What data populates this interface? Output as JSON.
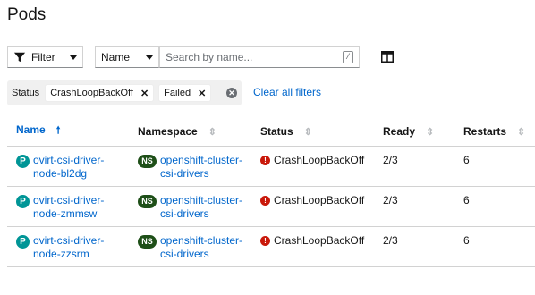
{
  "page": {
    "title": "Pods"
  },
  "toolbar": {
    "filter_label": "Filter",
    "name_select_label": "Name",
    "search_placeholder": "Search by name...",
    "search_shortcut": "/",
    "columns_icon": "columns-icon"
  },
  "filters": {
    "category": "Status",
    "chips": [
      "CrashLoopBackOff",
      "Failed"
    ],
    "clear_all_label": "Clear all filters"
  },
  "table": {
    "headers": [
      "Name",
      "Namespace",
      "Status",
      "Ready",
      "Restarts"
    ],
    "rows": [
      {
        "name": "ovirt-csi-driver-node-bl2dg",
        "namespace": "openshift-cluster-csi-drivers",
        "status": "CrashLoopBackOff",
        "ready": "2/3",
        "restarts": "6",
        "pod_badge": "P",
        "ns_badge": "NS"
      },
      {
        "name": "ovirt-csi-driver-node-zmmsw",
        "namespace": "openshift-cluster-csi-drivers",
        "status": "CrashLoopBackOff",
        "ready": "2/3",
        "restarts": "6",
        "pod_badge": "P",
        "ns_badge": "NS"
      },
      {
        "name": "ovirt-csi-driver-node-zzsrm",
        "namespace": "openshift-cluster-csi-drivers",
        "status": "CrashLoopBackOff",
        "ready": "2/3",
        "restarts": "6",
        "pod_badge": "P",
        "ns_badge": "NS"
      }
    ]
  },
  "colors": {
    "link": "#0066cc",
    "pod_badge": "#009596",
    "ns_badge": "#1e4f18",
    "error": "#c9190b"
  }
}
